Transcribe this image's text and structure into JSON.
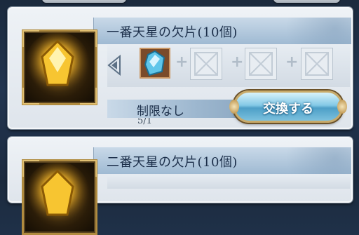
{
  "cards": [
    {
      "title": "一番天星の欠片(10個)",
      "material_count": "5/1",
      "limit_text": "制限なし",
      "exchange_label": "交換する",
      "item_icon": "golden-crystal-icon",
      "material_icon": "blue-crystal-icon"
    },
    {
      "title": "二番天星の欠片(10個)",
      "item_icon": "golden-crystal-icon"
    }
  ],
  "colors": {
    "title_text": "#1c2f4a",
    "button_gold_border": "#c8aa6a",
    "button_blue": "#4d9fc7"
  }
}
